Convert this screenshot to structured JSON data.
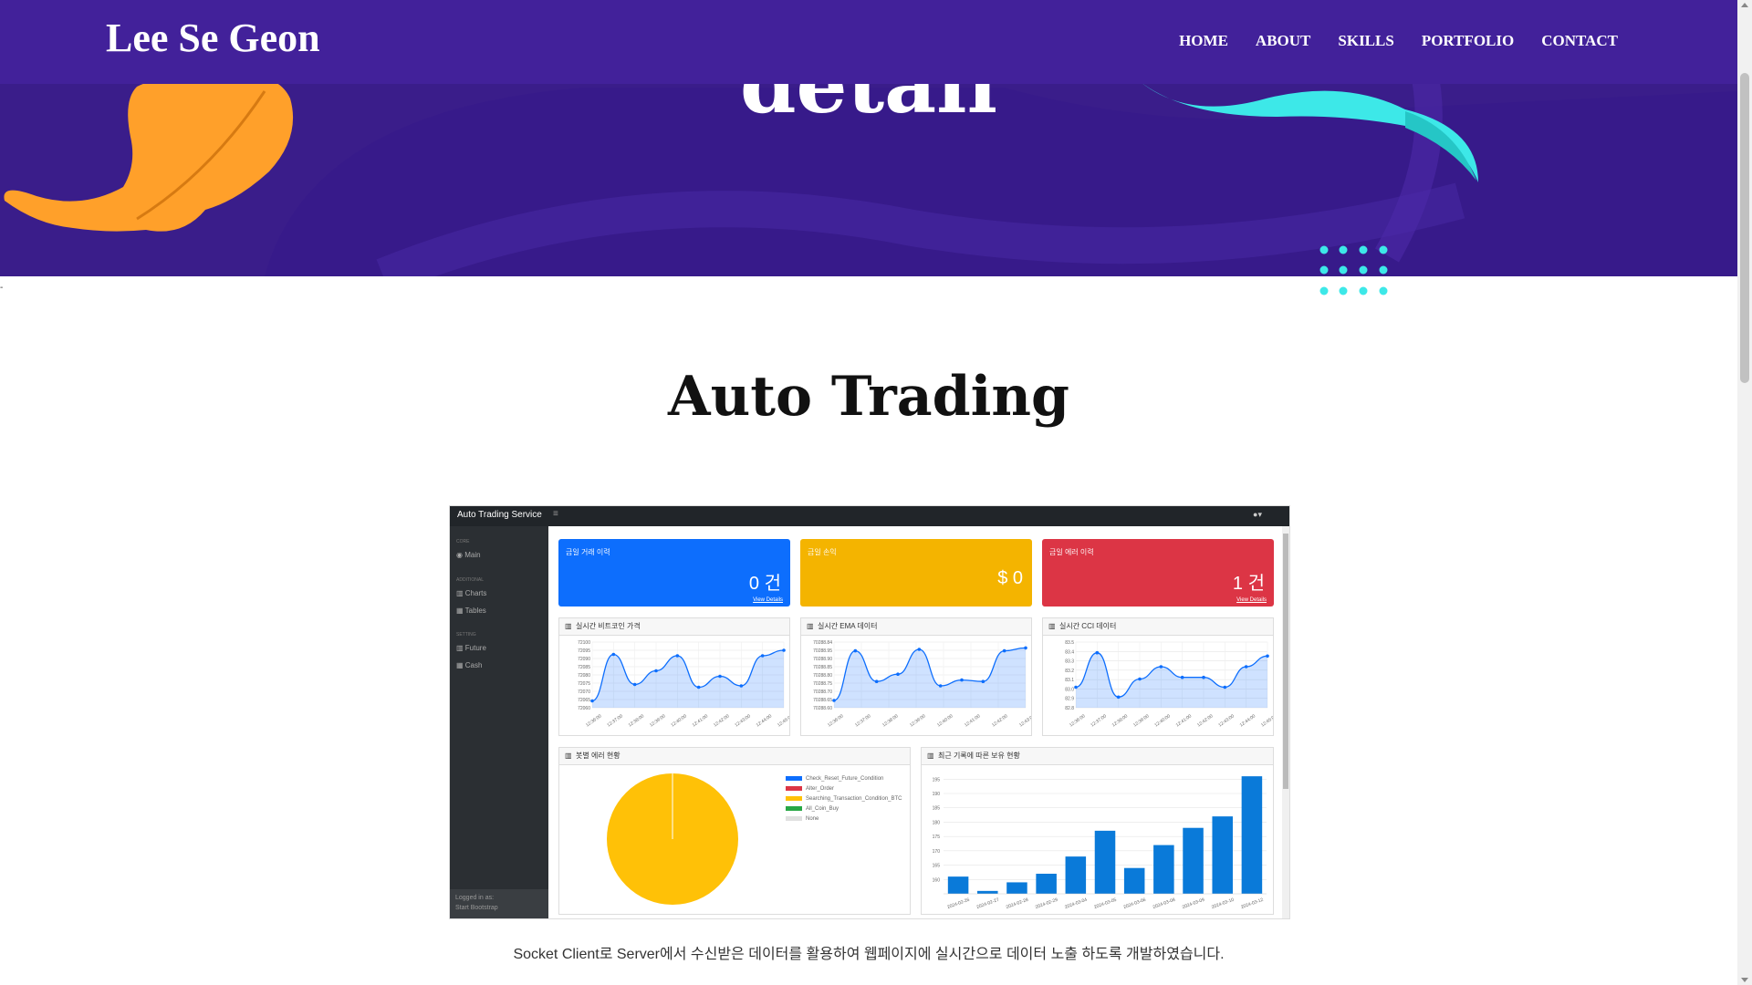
{
  "site": {
    "brand": "Lee Se Geon"
  },
  "nav": {
    "items": [
      "HOME",
      "ABOUT",
      "SKILLS",
      "PORTFOLIO",
      "CONTACT"
    ]
  },
  "hero": {
    "title": "detail",
    "colors": {
      "background": "#3a1d8a",
      "navbar": "#42219a",
      "leaf": "#ffa02a",
      "wave": "#3de8e8",
      "dots": "#3de8e8"
    }
  },
  "section": {
    "title": "Auto Trading",
    "caption": "Socket Client로 Server에서 수신받은 데이터를 활용하여 웹페이지에 실시간으로 데이터 노출 하도록 개발하였습니다."
  },
  "dashboard": {
    "brand": "Auto Trading Service",
    "menu_icon": "≡",
    "user_icon": "user-icon ▾",
    "sidebar": {
      "sections": [
        {
          "heading": "CORE",
          "items": [
            "Main"
          ]
        },
        {
          "heading": "ADDITIONAL",
          "items": [
            "Charts",
            "Tables"
          ]
        },
        {
          "heading": "SETTING",
          "items": [
            "Future",
            "Cash"
          ]
        }
      ],
      "footer": [
        "Logged in as:",
        "Start Bootstrap"
      ]
    },
    "cards": [
      {
        "title": "금일 거래 이력",
        "value": "0 건",
        "link": "View Details",
        "color": "#0d6efd"
      },
      {
        "title": "금일 손익",
        "value": "$ 0",
        "link": "",
        "color": "#ffc107"
      },
      {
        "title": "금일 에러 이력",
        "value": "1 건",
        "link": "View Details",
        "color": "#dc3545"
      }
    ],
    "line_panels": [
      {
        "title": "실시간 비트코인 가격"
      },
      {
        "title": "실시간 EMA 데이터"
      },
      {
        "title": "실시간 CCI 데이터"
      }
    ],
    "pie_panel": {
      "title": "봇별 에러 현황",
      "legend": [
        {
          "label": "Check_Reset_Future_Condition",
          "color": "#0d6efd"
        },
        {
          "label": "Alter_Order",
          "color": "#dc3545"
        },
        {
          "label": "Searching_Transaction_Condition_BTC",
          "color": "#ffc107"
        },
        {
          "label": "All_Coin_Buy",
          "color": "#28a745"
        },
        {
          "label": "None",
          "color": "#e0e0e0"
        }
      ]
    },
    "bar_panel": {
      "title": "최근 기록에 따른 보유 현황"
    }
  },
  "chart_data": [
    {
      "type": "line",
      "title": "실시간 비트코인 가격",
      "y_tick_labels": [
        "72100",
        "72095",
        "72090",
        "72085",
        "72080",
        "72075",
        "72070",
        "72065",
        "72060"
      ],
      "x_tick_labels": [
        "12:36:00",
        "12:37:00",
        "12:38:00",
        "12:39:00",
        "12:40:00",
        "12:41:00",
        "12:42:00",
        "12:43:00",
        "12:44:00",
        "12:45:00"
      ],
      "values": [
        72060,
        72094,
        72072,
        72082,
        72093,
        72070,
        72078,
        72071,
        72093,
        72097
      ],
      "ylim": [
        72055,
        72103
      ]
    },
    {
      "type": "line",
      "title": "실시간 EMA 데이터",
      "y_tick_labels": [
        "70288.84",
        "70288.95",
        "70288.90",
        "70288.85",
        "70288.80",
        "70288.75",
        "70288.70",
        "70288.65",
        "70288.60"
      ],
      "x_tick_labels": [
        "12:36:00",
        "12:37:00",
        "12:38:00",
        "12:39:00",
        "12:40:00",
        "12:41:00",
        "12:42:00",
        "12:43:00"
      ],
      "values": [
        70288.6,
        70288.94,
        70288.73,
        70288.78,
        70288.95,
        70288.7,
        70288.74,
        70288.73,
        70288.94,
        70288.96
      ],
      "ylim": [
        70288.55,
        70289.0
      ]
    },
    {
      "type": "line",
      "title": "실시간 CCI 데이터",
      "y_tick_labels": [
        "83.5",
        "83.4",
        "83.3",
        "83.2",
        "83.1",
        "83.0",
        "82.9",
        "82.8"
      ],
      "x_tick_labels": [
        "12:36:00",
        "12:37:00",
        "12:38:00",
        "12:39:00",
        "12:40:00",
        "12:41:00",
        "12:42:00",
        "12:43:00",
        "12:44:00",
        "12:45:00"
      ],
      "values": [
        83.0,
        83.42,
        82.88,
        83.1,
        83.25,
        83.12,
        83.12,
        83.0,
        83.25,
        83.38
      ],
      "ylim": [
        82.75,
        83.55
      ]
    },
    {
      "type": "pie",
      "title": "봇별 에러 현황",
      "labels": [
        "Check_Reset_Future_Condition",
        "Alter_Order",
        "Searching_Transaction_Condition_BTC",
        "All_Coin_Buy",
        "None"
      ],
      "values": [
        0,
        0,
        1,
        0,
        0
      ]
    },
    {
      "type": "bar",
      "title": "최근 기록에 따른 보유 현황",
      "categories": [
        "2024-02-26",
        "2024-02-27",
        "2024-02-28",
        "2024-02-29",
        "2024-03-04",
        "2024-03-05",
        "2024-03-06",
        "2024-03-08",
        "2024-03-09",
        "2024-03-10",
        "2024-03-12"
      ],
      "values": [
        161,
        156,
        159,
        162,
        168,
        177,
        164,
        172,
        178,
        182,
        196
      ],
      "y_tick_labels": [
        "195",
        "190",
        "185",
        "180",
        "175",
        "170",
        "165",
        "160"
      ],
      "ylim": [
        155,
        197
      ]
    }
  ]
}
